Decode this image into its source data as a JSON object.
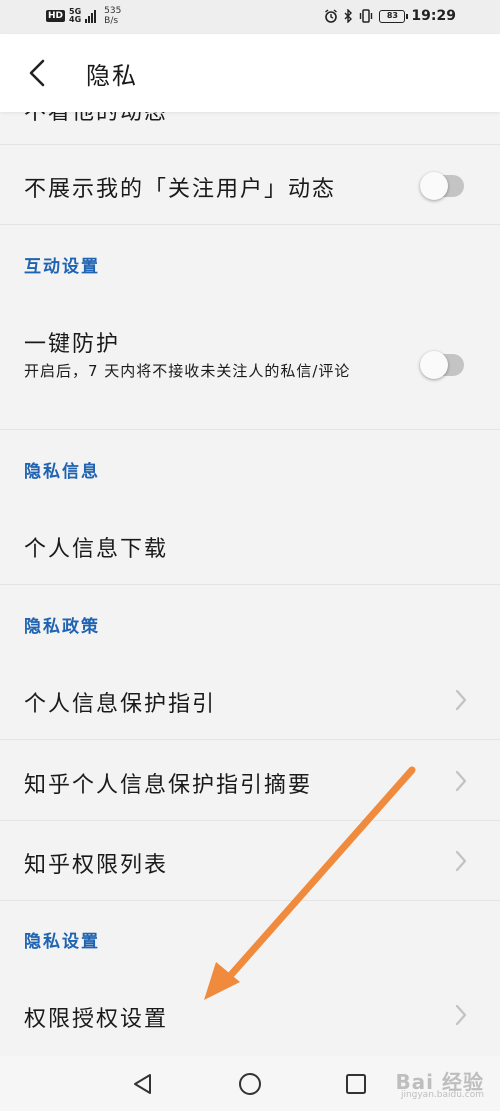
{
  "status_bar": {
    "hd": "HD",
    "net_top": "5G",
    "net_bottom": "4G",
    "speed_value": "535",
    "speed_unit": "B/s",
    "battery": "83",
    "time": "19:29"
  },
  "header": {
    "title": "隐私"
  },
  "rows": {
    "partial_top": "不看他的动态",
    "hide_following": "不展示我的「关注用户」动态",
    "one_key_protect": "一键防护",
    "one_key_protect_desc": "开启后，7 天内将不接收未关注人的私信/评论",
    "personal_info_download": "个人信息下载",
    "protection_guide": "个人信息保护指引",
    "guide_summary": "知乎个人信息保护指引摘要",
    "permission_list": "知乎权限列表",
    "permission_settings": "权限授权设置"
  },
  "sections": {
    "interaction": "互动设置",
    "privacy_info": "隐私信息",
    "privacy_policy": "隐私政策",
    "privacy_settings": "隐私设置"
  },
  "toggles": {
    "hide_following": false,
    "one_key_protect": false
  },
  "watermark": {
    "text": "Bai 经验",
    "sub": "jingyan.baidu.com"
  },
  "colors": {
    "section_blue": "#1f63b2",
    "annotation_arrow": "#f08a3c"
  },
  "icons": {
    "back": "chevron-left-icon",
    "row_arrow": "chevron-right-icon",
    "nav_back": "triangle-back-icon",
    "nav_home": "circle-home-icon",
    "nav_recent": "square-recent-icon"
  }
}
